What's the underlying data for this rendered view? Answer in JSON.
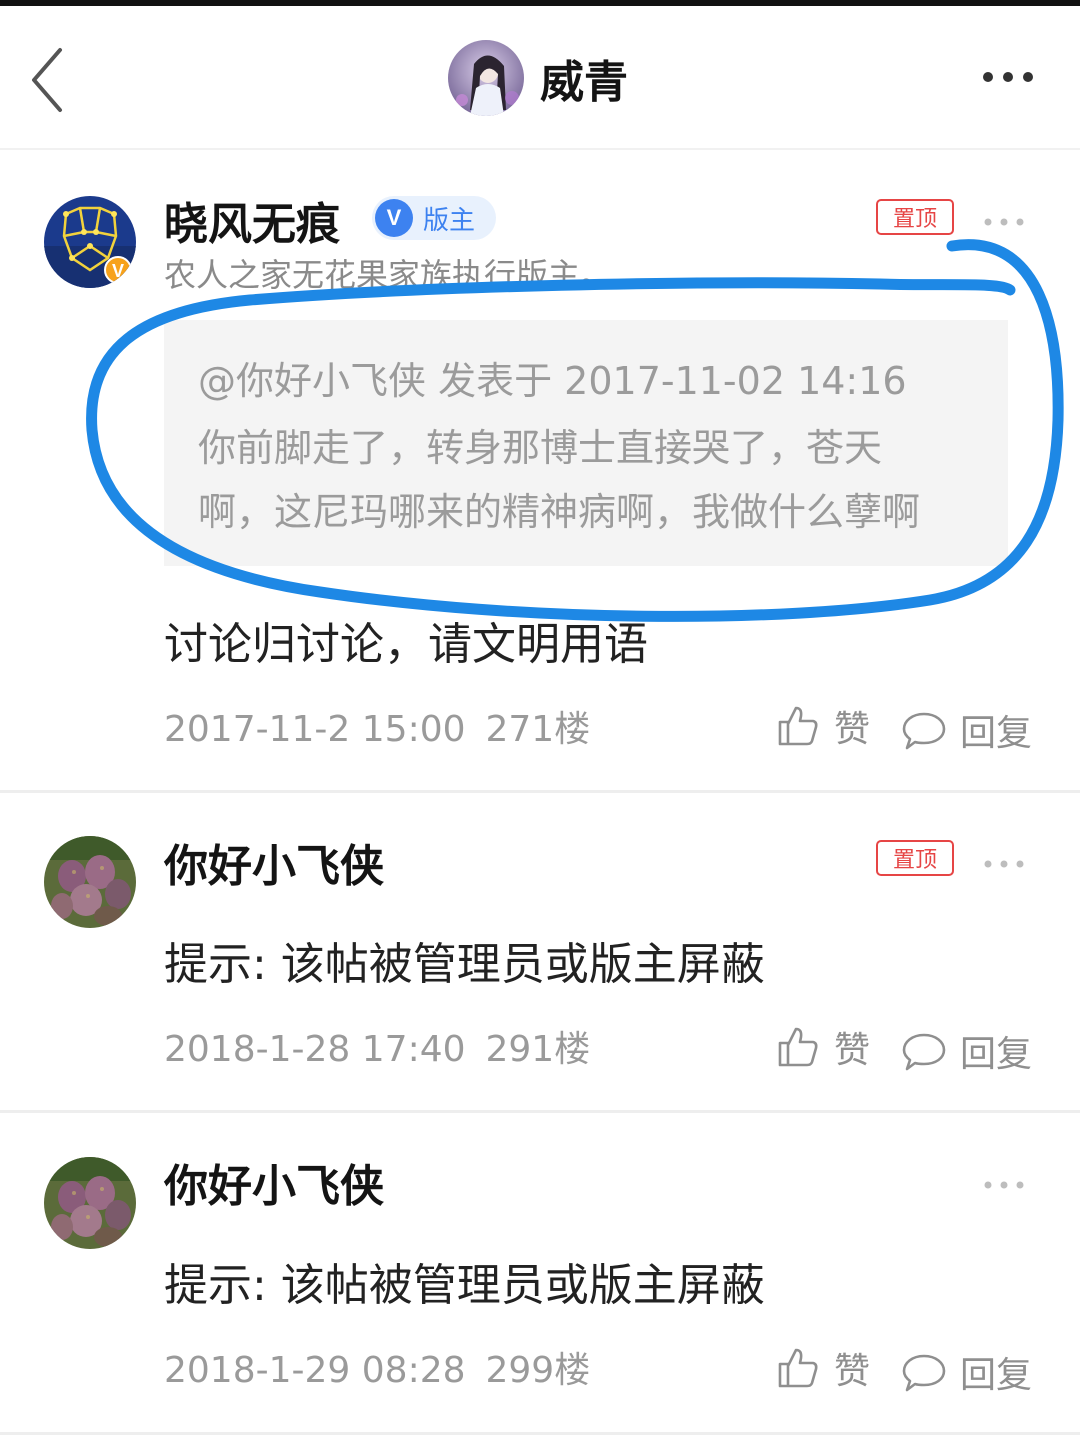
{
  "header": {
    "title": "威青",
    "back_icon": "chevron-left-icon",
    "more_icon": "more-horizontal-icon"
  },
  "posts": [
    {
      "username": "晓风无痕",
      "verified_mark": "V",
      "role_badge": "版主",
      "subtitle": "农人之家无花果家族执行版主。",
      "pin_label": "置顶",
      "quote": {
        "header": "@你好小飞侠 发表于 2017-11-02 14:16",
        "line1": "你前脚走了，转身那博士直接哭了，苍天",
        "line2": "啊，这尼玛哪来的精神病啊，我做什么孽啊"
      },
      "content": "讨论归讨论，请文明用语",
      "date": "2017-11-2 15:00",
      "floor": "271楼",
      "like_label": "赞",
      "reply_label": "回复"
    },
    {
      "username": "你好小飞侠",
      "pin_label": "置顶",
      "content": "提示: 该帖被管理员或版主屏蔽",
      "date": "2018-1-28 17:40",
      "floor": "291楼",
      "like_label": "赞",
      "reply_label": "回复"
    },
    {
      "username": "你好小飞侠",
      "content": "提示: 该帖被管理员或版主屏蔽",
      "date": "2018-1-29 08:28",
      "floor": "299楼",
      "like_label": "赞",
      "reply_label": "回复"
    }
  ],
  "colors": {
    "accent_blue": "#3d82f0",
    "pin_red": "#e64545",
    "annotation_blue": "#1e88e5",
    "muted_text": "#9a9a9a"
  }
}
